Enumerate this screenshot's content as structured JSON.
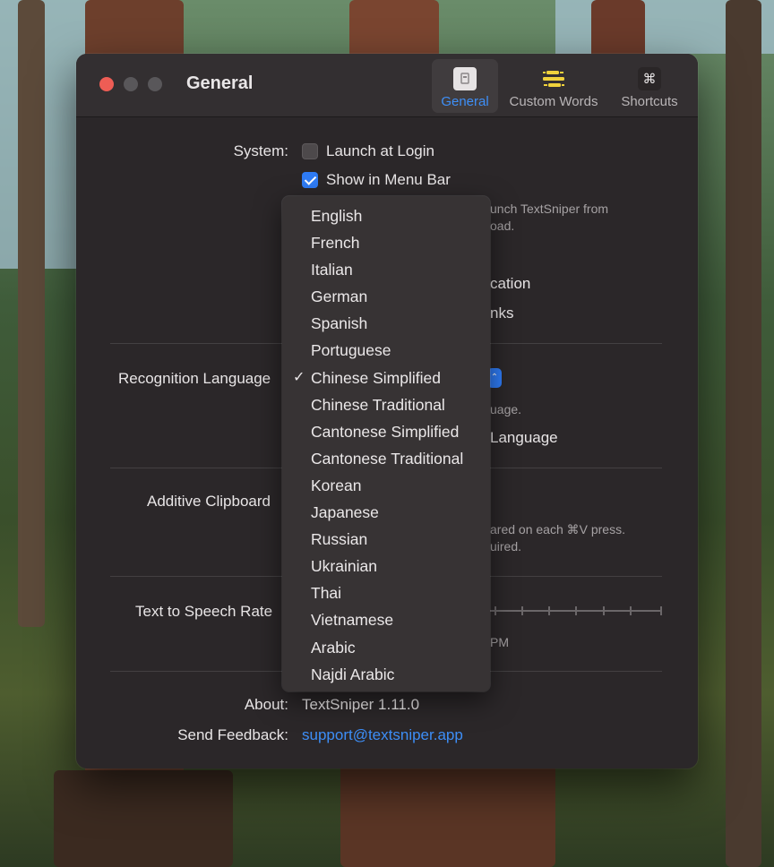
{
  "window": {
    "title": "General",
    "tabs": [
      {
        "label": "General",
        "icon": "general-icon",
        "active": true
      },
      {
        "label": "Custom Words",
        "icon": "custom-words-icon",
        "active": false
      },
      {
        "label": "Shortcuts",
        "icon": "command-icon",
        "active": false
      }
    ]
  },
  "system": {
    "label": "System:",
    "launch_at_login": {
      "label": "Launch at Login",
      "checked": false
    },
    "show_in_menu_bar": {
      "label": "Show in Menu Bar",
      "checked": true
    },
    "hint_line1": "unch TextSniper from",
    "hint_line2": "oad.",
    "partial_option1": "cation",
    "partial_option2": "nks"
  },
  "recognition": {
    "label": "Recognition Language",
    "hint": "uage.",
    "partial_option": "Language"
  },
  "clipboard": {
    "label": "Additive Clipboard",
    "hint_line1": "ared on each ⌘V press.",
    "hint_line2": "uired."
  },
  "tts": {
    "label": "Text to Speech Rate",
    "value_suffix": "PM"
  },
  "about": {
    "label": "About:",
    "value": "TextSniper 1.11.0"
  },
  "feedback": {
    "label": "Send Feedback:",
    "value": "support@textsniper.app"
  },
  "language_menu": {
    "selected": "Chinese Simplified",
    "check_glyph": "✓",
    "items": [
      "English",
      "French",
      "Italian",
      "German",
      "Spanish",
      "Portuguese",
      "Chinese Simplified",
      "Chinese Traditional",
      "Cantonese Simplified",
      "Cantonese Traditional",
      "Korean",
      "Japanese",
      "Russian",
      "Ukrainian",
      "Thai",
      "Vietnamese",
      "Arabic",
      "Najdi Arabic"
    ]
  },
  "colors": {
    "accent": "#2f7cf6",
    "link": "#3d8ef7",
    "close_button": "#ee5d55",
    "window_bg": "#2b2729"
  }
}
